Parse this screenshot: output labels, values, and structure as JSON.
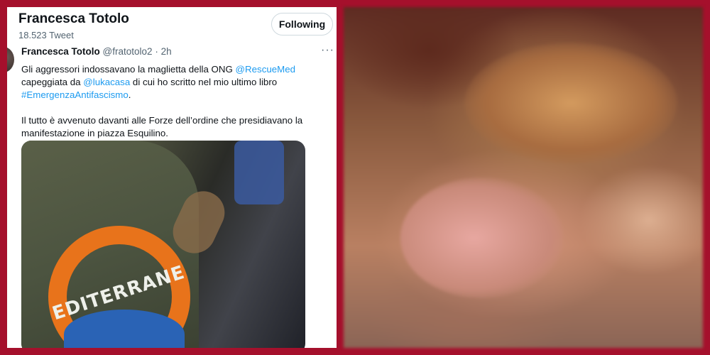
{
  "profile": {
    "name": "Francesca Totolo",
    "tweet_count": "18.523 Tweet",
    "follow_label": "Following"
  },
  "tweet": {
    "author": "Francesca Totolo",
    "handle": "@fratotolo2",
    "separator": "·",
    "time": "2h",
    "more": "···",
    "text": {
      "p1_a": "Gli aggressori indossavano la maglietta della ONG ",
      "mention1": "@RescueMed",
      "p1_b": " capeggiata da ",
      "mention2": "@lukacasa",
      "p1_c": " di cui ho scritto nel mio ultimo libro ",
      "hashtag": "#EmergenzaAntifascismo",
      "p1_d": ".",
      "p2": "Il tutto è avvenuto davanti alle Forze dell’ordine che presidiavano la manifestazione in piazza Esquilino."
    },
    "media_text": "EDITERRANE"
  }
}
